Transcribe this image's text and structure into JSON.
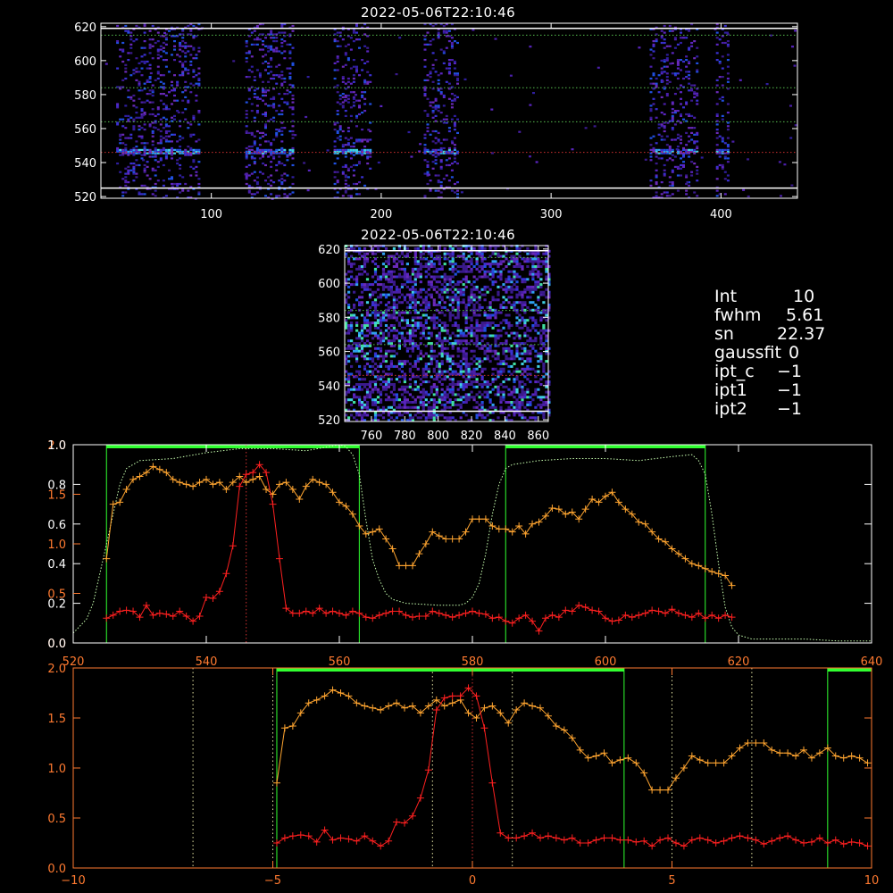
{
  "panel1": {
    "title": "2022-05-06T22:10:46",
    "xticks": [
      "100",
      "200",
      "300",
      "400"
    ],
    "yticks": [
      "520",
      "540",
      "560",
      "580",
      "600",
      "620"
    ],
    "xlim": [
      35,
      445
    ],
    "ylim": [
      519,
      622
    ],
    "bright_rows": [
      546
    ],
    "guide_rows_green": [
      564,
      584,
      615
    ],
    "guide_rows_white": [
      525,
      619
    ],
    "bands": [
      [
        44,
        92
      ],
      [
        120,
        148
      ],
      [
        172,
        194
      ],
      [
        225,
        245
      ],
      [
        358,
        386
      ],
      [
        397,
        405
      ]
    ]
  },
  "panel2": {
    "title": "2022-05-06T22:10:46",
    "xticks": [
      "760",
      "780",
      "800",
      "820",
      "840",
      "860"
    ],
    "yticks": [
      "520",
      "540",
      "560",
      "580",
      "600",
      "620"
    ],
    "xlim": [
      744,
      866
    ],
    "ylim": [
      519,
      622
    ]
  },
  "info": [
    {
      "key": "Int",
      "value": "10"
    },
    {
      "key": "fwhm",
      "value": "5.61"
    },
    {
      "key": "sn",
      "value": "22.37"
    },
    {
      "key": "gaussfit",
      "value": "0"
    },
    {
      "key": "ipt_c",
      "value": "−1"
    },
    {
      "key": "ipt1",
      "value": "−1"
    },
    {
      "key": "ipt2",
      "value": "−1"
    }
  ],
  "chart_data": [
    {
      "type": "line",
      "xlim": [
        520,
        640
      ],
      "xticks": [
        "520",
        "540",
        "560",
        "580",
        "600",
        "620",
        "640"
      ],
      "ylim_left_orange": [
        0.0,
        2.0
      ],
      "yticks_left_orange": [
        "0.0",
        "0.5",
        "1.0",
        "1.5",
        "2.0"
      ],
      "ylim_left_white": [
        0.0,
        1.0
      ],
      "yticks_left_white": [
        "0.0",
        "0.2",
        "0.4",
        "0.6",
        "0.8",
        "1.0"
      ],
      "green_bars": [
        [
          525,
          563
        ],
        [
          585,
          615
        ]
      ],
      "red_vline": 546,
      "series": [
        {
          "color": "#ffa530",
          "x": [
            525,
            526,
            527,
            528,
            529,
            530,
            531,
            532,
            533,
            534,
            535,
            536,
            537,
            538,
            539,
            540,
            541,
            542,
            543,
            544,
            545,
            546,
            547,
            548,
            549,
            550,
            551,
            552,
            553,
            554,
            555,
            556,
            557,
            558,
            559,
            560,
            561,
            562,
            563,
            564,
            565,
            566,
            567,
            568,
            569,
            570,
            571,
            572,
            573,
            574,
            575,
            576,
            577,
            578,
            579,
            580,
            581,
            582,
            583,
            584,
            585,
            586,
            587,
            588,
            589,
            590,
            591,
            592,
            593,
            594,
            595,
            596,
            597,
            598,
            599,
            600,
            601,
            602,
            603,
            604,
            605,
            606,
            607,
            608,
            609,
            610,
            611,
            612,
            613,
            614,
            615,
            616,
            617,
            618,
            619
          ],
          "values": [
            0.85,
            1.4,
            1.42,
            1.55,
            1.65,
            1.68,
            1.72,
            1.78,
            1.75,
            1.72,
            1.65,
            1.62,
            1.6,
            1.58,
            1.62,
            1.65,
            1.6,
            1.62,
            1.55,
            1.62,
            1.68,
            1.62,
            1.65,
            1.68,
            1.55,
            1.5,
            1.6,
            1.62,
            1.55,
            1.45,
            1.58,
            1.65,
            1.62,
            1.6,
            1.52,
            1.42,
            1.38,
            1.3,
            1.18,
            1.1,
            1.12,
            1.15,
            1.05,
            0.95,
            0.78,
            0.78,
            0.78,
            0.9,
            1.0,
            1.12,
            1.08,
            1.05,
            1.05,
            1.05,
            1.12,
            1.25,
            1.25,
            1.25,
            1.18,
            1.15,
            1.15,
            1.12,
            1.18,
            1.1,
            1.2,
            1.22,
            1.28,
            1.36,
            1.35,
            1.3,
            1.32,
            1.25,
            1.35,
            1.45,
            1.42,
            1.48,
            1.52,
            1.42,
            1.35,
            1.3,
            1.22,
            1.2,
            1.12,
            1.05,
            1.02,
            0.95,
            0.9,
            0.85,
            0.8,
            0.78,
            0.75,
            0.72,
            0.7,
            0.68,
            0.58
          ]
        },
        {
          "color": "#ff2020",
          "x": [
            525,
            526,
            527,
            528,
            529,
            530,
            531,
            532,
            533,
            534,
            535,
            536,
            537,
            538,
            539,
            540,
            541,
            542,
            543,
            544,
            545,
            546,
            547,
            548,
            549,
            550,
            551,
            552,
            553,
            554,
            555,
            556,
            557,
            558,
            559,
            560,
            561,
            562,
            563,
            564,
            565,
            566,
            567,
            568,
            569,
            570,
            571,
            572,
            573,
            574,
            575,
            576,
            577,
            578,
            579,
            580,
            581,
            582,
            583,
            584,
            585,
            586,
            587,
            588,
            589,
            590,
            591,
            592,
            593,
            594,
            595,
            596,
            597,
            598,
            599,
            600,
            601,
            602,
            603,
            604,
            605,
            606,
            607,
            608,
            609,
            610,
            611,
            612,
            613,
            614,
            615,
            616,
            617,
            618,
            619
          ],
          "values": [
            0.25,
            0.28,
            0.32,
            0.33,
            0.32,
            0.26,
            0.38,
            0.28,
            0.3,
            0.29,
            0.27,
            0.32,
            0.27,
            0.22,
            0.27,
            0.46,
            0.45,
            0.52,
            0.7,
            0.98,
            1.58,
            1.7,
            1.72,
            1.8,
            1.72,
            1.4,
            0.85,
            0.35,
            0.3,
            0.3,
            0.32,
            0.3,
            0.35,
            0.3,
            0.32,
            0.3,
            0.28,
            0.32,
            0.3,
            0.26,
            0.25,
            0.28,
            0.3,
            0.32,
            0.32,
            0.28,
            0.26,
            0.27,
            0.27,
            0.32,
            0.3,
            0.28,
            0.26,
            0.28,
            0.3,
            0.32,
            0.3,
            0.29,
            0.25,
            0.26,
            0.22,
            0.2,
            0.25,
            0.28,
            0.22,
            0.12,
            0.25,
            0.28,
            0.26,
            0.33,
            0.32,
            0.38,
            0.36,
            0.33,
            0.32,
            0.25,
            0.22,
            0.23,
            0.28,
            0.26,
            0.28,
            0.3,
            0.33,
            0.32,
            0.3,
            0.34,
            0.3,
            0.28,
            0.26,
            0.3,
            0.25,
            0.28,
            0.25,
            0.28,
            0.26
          ]
        },
        {
          "color": "#c8ffb0",
          "dotted": true,
          "x": [
            520,
            522,
            523,
            524,
            525,
            526,
            527,
            528,
            530,
            535,
            540,
            545,
            550,
            555,
            560,
            561,
            562,
            563,
            564,
            565,
            566,
            567,
            568,
            570,
            575,
            578,
            579,
            580,
            581,
            582,
            583,
            584,
            585,
            586,
            588,
            590,
            595,
            600,
            605,
            610,
            613,
            614,
            615,
            616,
            617,
            618,
            619,
            620,
            622,
            625,
            630,
            635,
            640
          ],
          "values": [
            0.05,
            0.12,
            0.2,
            0.35,
            0.5,
            0.65,
            0.8,
            0.88,
            0.92,
            0.93,
            0.96,
            0.98,
            0.98,
            0.97,
            1.0,
            0.99,
            0.95,
            0.85,
            0.62,
            0.42,
            0.32,
            0.25,
            0.22,
            0.2,
            0.19,
            0.19,
            0.2,
            0.23,
            0.3,
            0.45,
            0.65,
            0.8,
            0.88,
            0.9,
            0.91,
            0.92,
            0.93,
            0.93,
            0.92,
            0.94,
            0.95,
            0.92,
            0.85,
            0.65,
            0.4,
            0.18,
            0.08,
            0.04,
            0.02,
            0.02,
            0.02,
            0.01,
            0.01
          ]
        }
      ]
    },
    {
      "type": "line",
      "xlim": [
        -10,
        10
      ],
      "xticks": [
        "−10",
        "−5",
        "0",
        "5",
        "10"
      ],
      "ylim": [
        0.0,
        2.0
      ],
      "yticks": [
        "0.0",
        "0.5",
        "1.0",
        "1.5",
        "2.0"
      ],
      "green_bars": [
        [
          -4.9,
          3.8
        ],
        [
          8.9,
          10
        ]
      ],
      "red_vline": 0,
      "dotted_vlines": [
        -7.0,
        -5.0,
        -1.0,
        1.0,
        5.0,
        7.0
      ],
      "series": [
        {
          "color": "#ffa530",
          "x": [
            -4.9,
            -4.7,
            -4.5,
            -4.3,
            -4.1,
            -3.9,
            -3.7,
            -3.5,
            -3.3,
            -3.1,
            -2.9,
            -2.7,
            -2.5,
            -2.3,
            -2.1,
            -1.9,
            -1.7,
            -1.5,
            -1.3,
            -1.1,
            -0.9,
            -0.7,
            -0.5,
            -0.3,
            -0.1,
            0.1,
            0.3,
            0.5,
            0.7,
            0.9,
            1.1,
            1.3,
            1.5,
            1.7,
            1.9,
            2.1,
            2.3,
            2.5,
            2.7,
            2.9,
            3.1,
            3.3,
            3.5,
            3.7,
            3.9,
            4.1,
            4.3,
            4.5,
            4.7,
            4.9,
            5.1,
            5.3,
            5.5,
            5.7,
            5.9,
            6.1,
            6.3,
            6.5,
            6.7,
            6.9,
            7.1,
            7.3,
            7.5,
            7.7,
            7.9,
            8.1,
            8.3,
            8.5,
            8.7,
            8.9,
            9.1,
            9.3,
            9.5,
            9.7,
            9.9
          ],
          "values": [
            0.85,
            1.4,
            1.42,
            1.55,
            1.65,
            1.68,
            1.72,
            1.78,
            1.75,
            1.72,
            1.65,
            1.62,
            1.6,
            1.58,
            1.62,
            1.65,
            1.6,
            1.62,
            1.55,
            1.62,
            1.68,
            1.62,
            1.65,
            1.68,
            1.55,
            1.5,
            1.6,
            1.62,
            1.55,
            1.45,
            1.58,
            1.65,
            1.62,
            1.6,
            1.52,
            1.42,
            1.38,
            1.3,
            1.18,
            1.1,
            1.12,
            1.15,
            1.05,
            1.08,
            1.1,
            1.05,
            0.95,
            0.78,
            0.78,
            0.78,
            0.9,
            1.0,
            1.12,
            1.08,
            1.05,
            1.05,
            1.05,
            1.12,
            1.2,
            1.25,
            1.25,
            1.25,
            1.18,
            1.15,
            1.15,
            1.12,
            1.18,
            1.1,
            1.15,
            1.2,
            1.12,
            1.1,
            1.12,
            1.1,
            1.05
          ]
        },
        {
          "color": "#ff2020",
          "x": [
            -4.9,
            -4.7,
            -4.5,
            -4.3,
            -4.1,
            -3.9,
            -3.7,
            -3.5,
            -3.3,
            -3.1,
            -2.9,
            -2.7,
            -2.5,
            -2.3,
            -2.1,
            -1.9,
            -1.7,
            -1.5,
            -1.3,
            -1.1,
            -0.9,
            -0.7,
            -0.5,
            -0.3,
            -0.1,
            0.1,
            0.3,
            0.5,
            0.7,
            0.9,
            1.1,
            1.3,
            1.5,
            1.7,
            1.9,
            2.1,
            2.3,
            2.5,
            2.7,
            2.9,
            3.1,
            3.3,
            3.5,
            3.7,
            3.9,
            4.1,
            4.3,
            4.5,
            4.7,
            4.9,
            5.1,
            5.3,
            5.5,
            5.7,
            5.9,
            6.1,
            6.3,
            6.5,
            6.7,
            6.9,
            7.1,
            7.3,
            7.5,
            7.7,
            7.9,
            8.1,
            8.3,
            8.5,
            8.7,
            8.9,
            9.1,
            9.3,
            9.5,
            9.7,
            9.9
          ],
          "values": [
            0.25,
            0.3,
            0.32,
            0.33,
            0.32,
            0.26,
            0.38,
            0.28,
            0.3,
            0.29,
            0.27,
            0.32,
            0.27,
            0.22,
            0.27,
            0.46,
            0.45,
            0.52,
            0.7,
            0.98,
            1.58,
            1.7,
            1.72,
            1.72,
            1.8,
            1.72,
            1.4,
            0.85,
            0.35,
            0.3,
            0.3,
            0.32,
            0.35,
            0.3,
            0.32,
            0.3,
            0.28,
            0.3,
            0.25,
            0.25,
            0.28,
            0.3,
            0.3,
            0.28,
            0.28,
            0.26,
            0.27,
            0.22,
            0.28,
            0.3,
            0.25,
            0.22,
            0.28,
            0.3,
            0.28,
            0.25,
            0.27,
            0.3,
            0.32,
            0.3,
            0.28,
            0.24,
            0.27,
            0.3,
            0.32,
            0.28,
            0.25,
            0.26,
            0.3,
            0.25,
            0.28,
            0.24,
            0.26,
            0.25,
            0.22
          ]
        }
      ]
    }
  ]
}
